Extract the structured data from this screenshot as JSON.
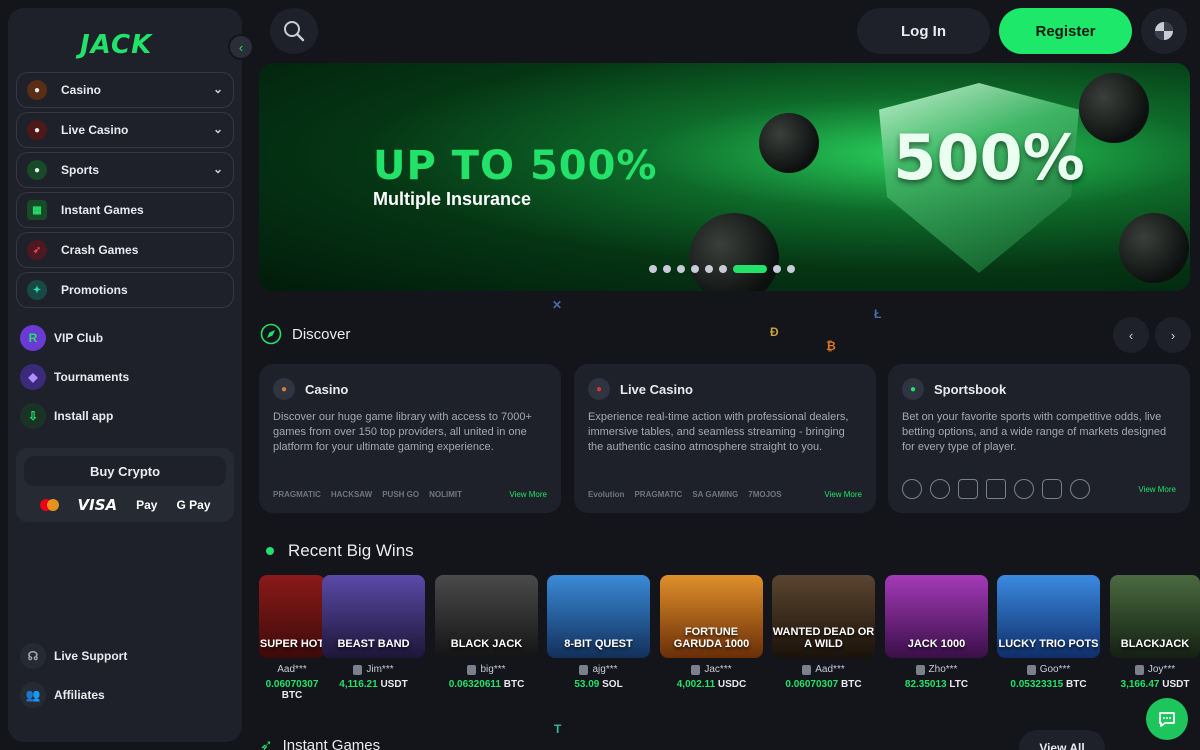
{
  "sidebar": {
    "logo": "JACK",
    "nav": [
      {
        "label": "Casino",
        "chevron": true,
        "color": "#c0581f"
      },
      {
        "label": "Live Casino",
        "chevron": true,
        "color": "#c02a2a"
      },
      {
        "label": "Sports",
        "chevron": true,
        "color": "#1f9a48"
      },
      {
        "label": "Instant Games",
        "chevron": false,
        "color": "#1fa35a"
      },
      {
        "label": "Crash Games",
        "chevron": false,
        "color": "#b12a35"
      },
      {
        "label": "Promotions",
        "chevron": false,
        "color": "#1f8a80"
      }
    ],
    "extras": [
      {
        "label": "VIP Club",
        "icon": "R"
      },
      {
        "label": "Tournaments",
        "icon": "◆"
      },
      {
        "label": "Install app",
        "icon": "⇩"
      }
    ],
    "buy_crypto": "Buy Crypto",
    "payments": {
      "visa": "VISA",
      "apple": "Pay",
      "google": "G Pay"
    },
    "support": "Live Support",
    "affiliates": "Affiliates"
  },
  "topbar": {
    "login": "Log In",
    "register": "Register"
  },
  "banner": {
    "headline": "UP TO 500%",
    "subline": "Multiple Insurance",
    "badge": "500%",
    "dot_count": 9,
    "active_dot": 6
  },
  "discover": {
    "title": "Discover",
    "cards": [
      {
        "title": "Casino",
        "desc": "Discover our huge game library with access to 7000+ games from over 150 top providers, all united in one platform for your ultimate gaming experience.",
        "providers": [
          "PRAGMATIC",
          "HACKSAW",
          "PUSH GO",
          "NOLIMIT"
        ],
        "view_more": "View More"
      },
      {
        "title": "Live Casino",
        "desc": "Experience real-time action with professional dealers, immersive tables, and seamless streaming - bringing the authentic casino atmosphere straight to you.",
        "providers": [
          "Evolution",
          "PRAGMATIC",
          "SA GAMING",
          "7MOJOS"
        ],
        "view_more": "View More"
      },
      {
        "title": "Sportsbook",
        "desc": "Bet on your favorite sports with competitive odds, live betting options, and a wide range of markets designed for every type of player.",
        "providers": [],
        "view_more": "View More"
      }
    ]
  },
  "recent_wins": {
    "title": "Recent Big Wins",
    "items": [
      {
        "game": "SUPER HOT",
        "user": "Aad***",
        "amount": "0.06070307",
        "currency": "BTC",
        "bg": "#6b1212"
      },
      {
        "game": "BEAST BAND",
        "user": "Jim***",
        "amount": "4,116.21",
        "currency": "USDT",
        "bg": "#3a2f6a"
      },
      {
        "game": "BLACK JACK",
        "user": "big***",
        "amount": "0.06320611",
        "currency": "BTC",
        "bg": "#2a2a2a"
      },
      {
        "game": "8-BIT QUEST",
        "user": "ajg***",
        "amount": "53.09",
        "currency": "SOL",
        "bg": "#1e4d8a"
      },
      {
        "game": "FORTUNE GARUDA 1000",
        "user": "Jac***",
        "amount": "4,002.11",
        "currency": "USDC",
        "bg": "#a5510c"
      },
      {
        "game": "WANTED DEAD OR A WILD",
        "user": "Aad***",
        "amount": "0.06070307",
        "currency": "BTC",
        "bg": "#3a2b1e"
      },
      {
        "game": "JACK 1000",
        "user": "Zho***",
        "amount": "82.35013",
        "currency": "LTC",
        "bg": "#6a1d7a"
      },
      {
        "game": "LUCKY TRIO POTS",
        "user": "Goo***",
        "amount": "0.05323315",
        "currency": "BTC",
        "bg": "#1e5aa5"
      },
      {
        "game": "BLACKJACK",
        "user": "Joy***",
        "amount": "3,166.47",
        "currency": "USDT",
        "bg": "#2c4a2a"
      }
    ]
  },
  "instant_games": {
    "title": "Instant Games",
    "view_all": "View All"
  },
  "colors": {
    "accent": "#22e26a",
    "background": "#13151b",
    "panel": "#1e2129"
  }
}
